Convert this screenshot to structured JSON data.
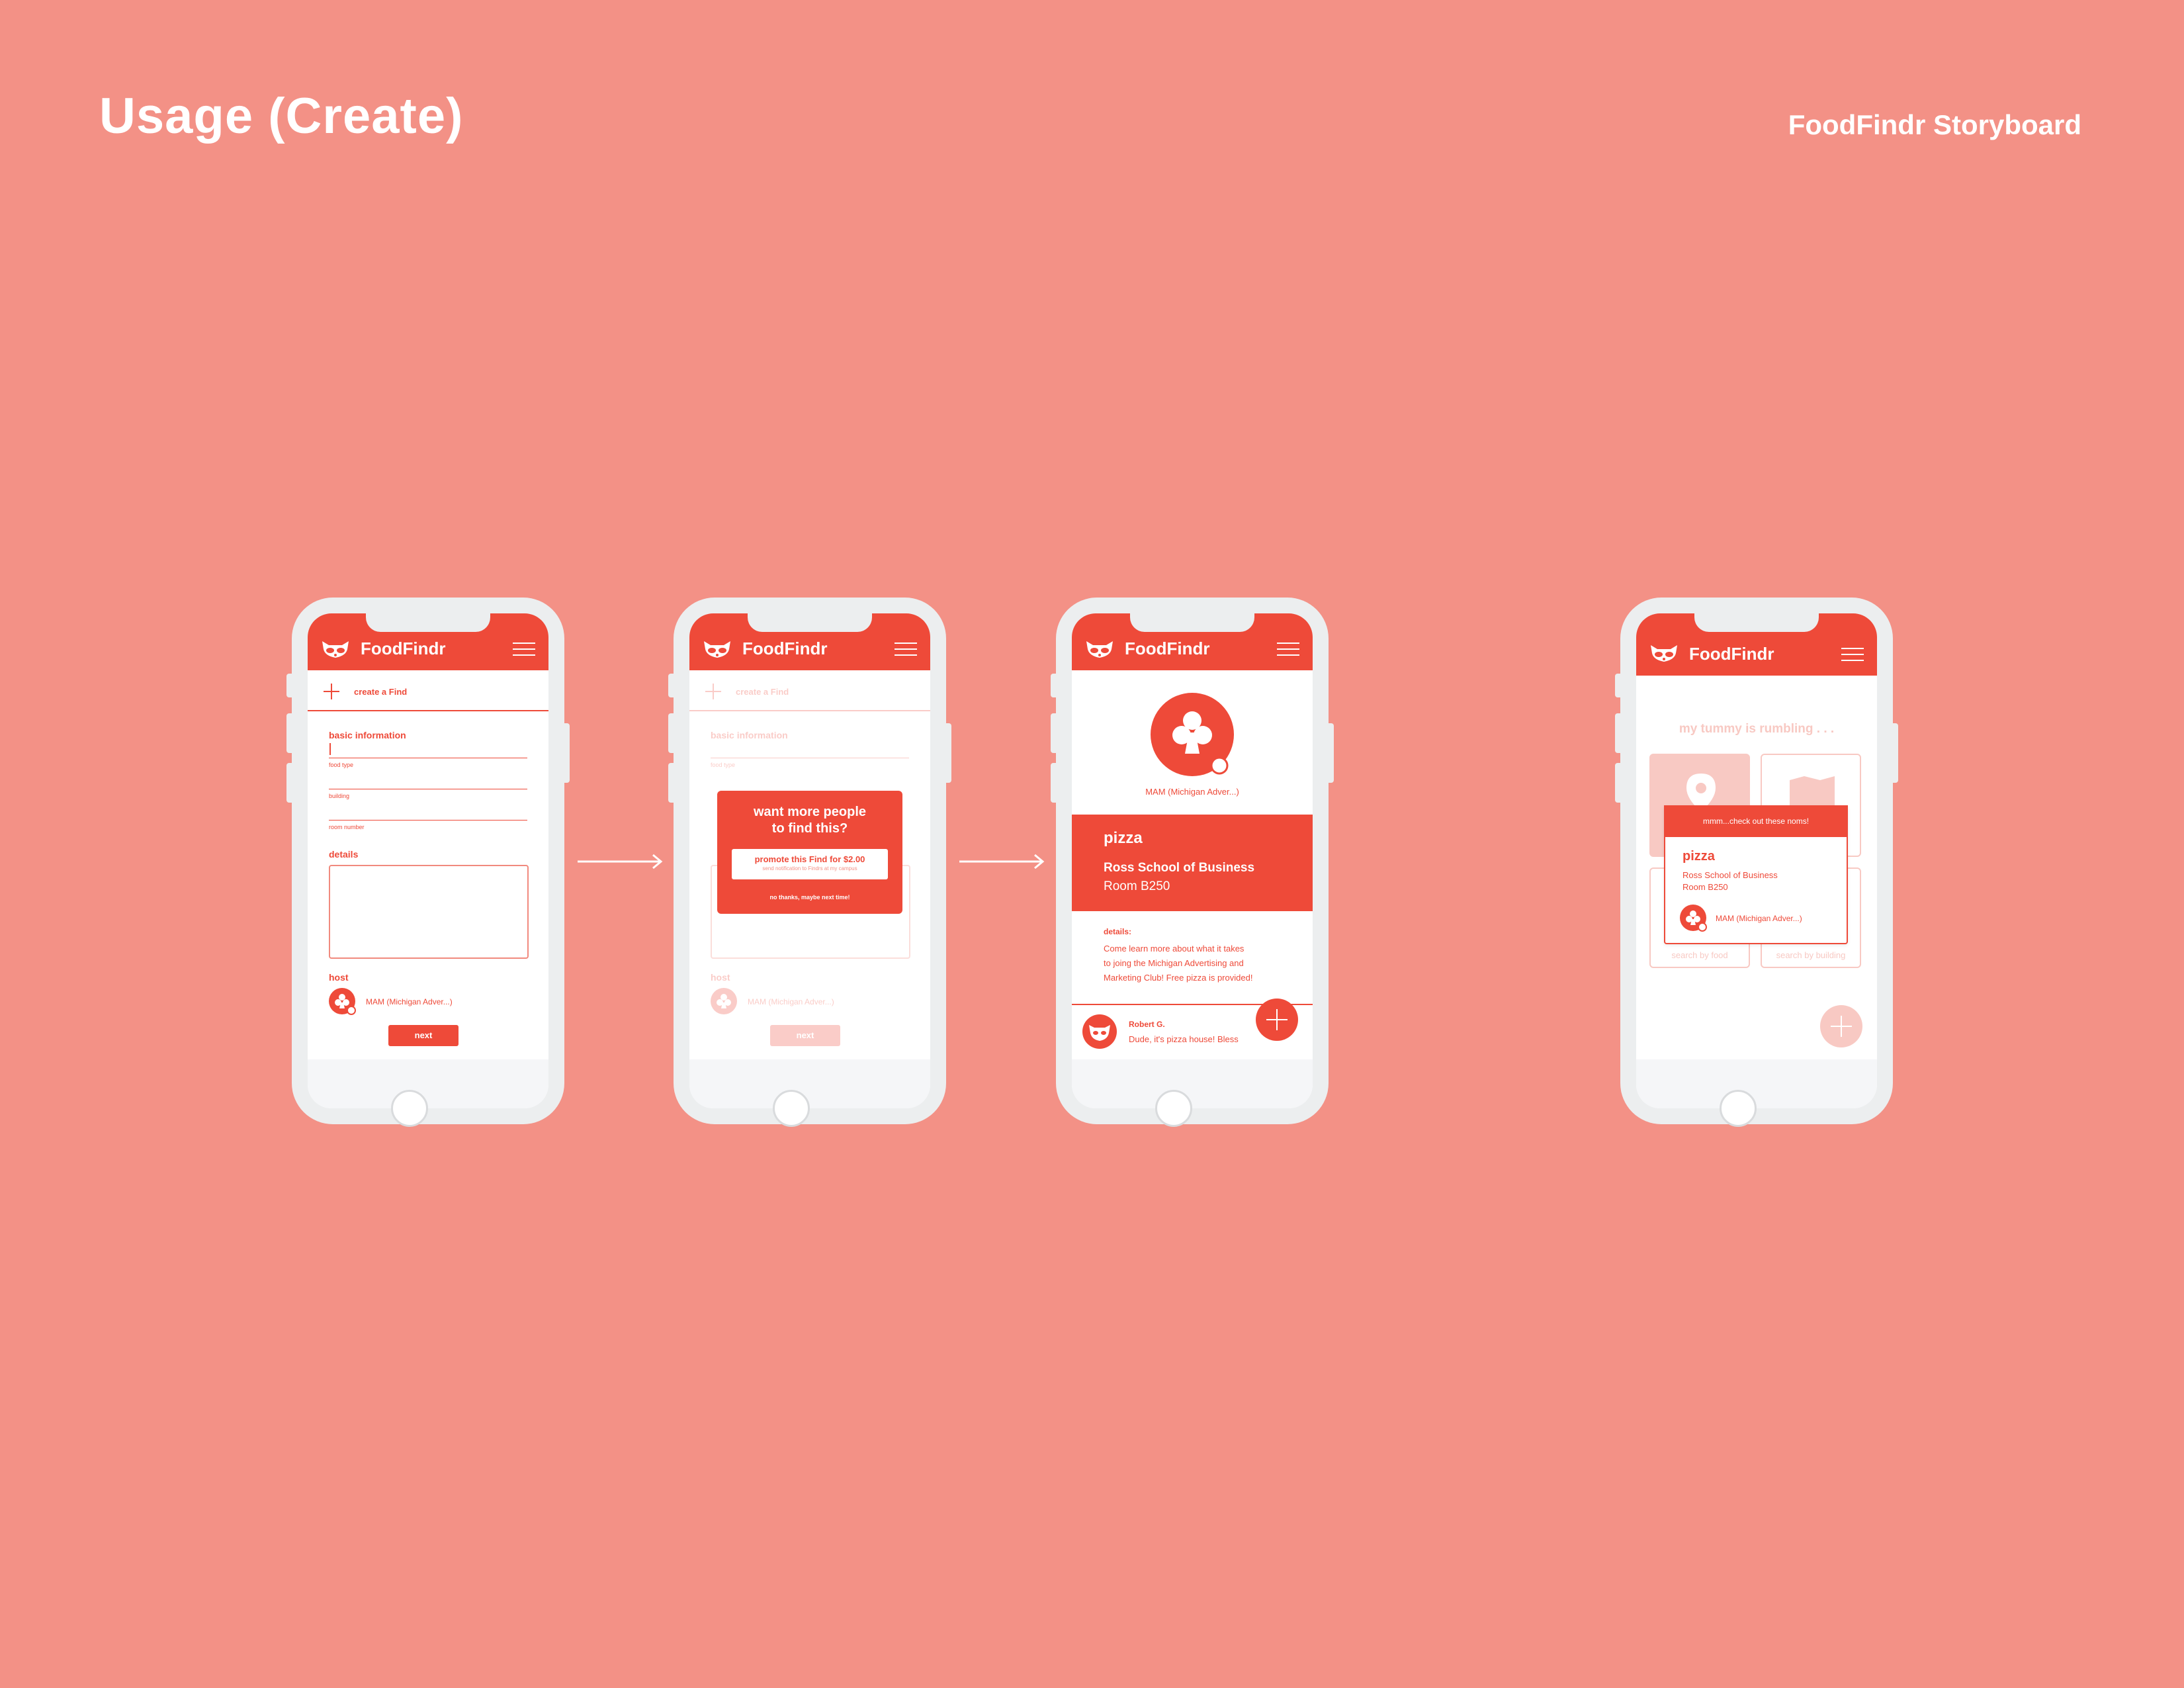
{
  "header": {
    "page_title": "Usage (Create)",
    "brand_title": "FoodFindr Storyboard"
  },
  "app": {
    "name": "FoodFindr"
  },
  "create_form": {
    "create_label": "create a Find",
    "section_basic": "basic information",
    "field_food_type": "food type",
    "field_building": "building",
    "field_room": "room number",
    "section_details": "details",
    "section_host": "host",
    "host_name": "MAM (Michigan Adver...)",
    "next_label": "next"
  },
  "promo_popup": {
    "title_line1": "want more people",
    "title_line2": "to find this?",
    "promote_label": "promote this Find for $2.00",
    "promote_sub": "send notification to Findrs at my campus",
    "dismiss_label": "no thanks, maybe next time!"
  },
  "find_detail": {
    "host_name": "MAM (Michigan Adver...)",
    "food": "pizza",
    "building": "Ross School of Business",
    "room": "Room B250",
    "details_label": "details:",
    "details_text_1": "Come learn more about what it takes",
    "details_text_2": "to joing the Michigan Advertising and",
    "details_text_3": "Marketing Club! Free pizza is provided!",
    "comment_author": "Robert G.",
    "comment_text": "Dude, it's pizza house! Bless"
  },
  "home": {
    "tagline": "my tummy is rumbling . . .",
    "tile_food": "search by food",
    "tile_building": "search by building",
    "notif_title": "mmm...check out these noms!",
    "notif_food": "pizza",
    "notif_building": "Ross School of Business",
    "notif_room": "Room B250",
    "notif_host": "MAM (Michigan Adver...)"
  },
  "colors": {
    "background": "#f39186",
    "accent": "#ee4a39",
    "phone": "#eceeef"
  }
}
